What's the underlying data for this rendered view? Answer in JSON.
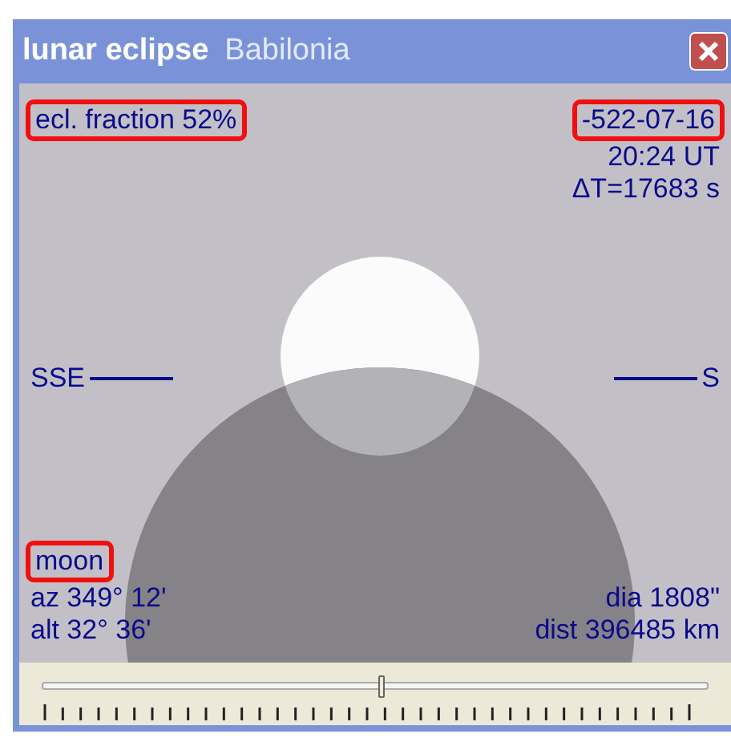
{
  "window": {
    "title": "lunar eclipse",
    "subtitle": "Babilonia"
  },
  "info": {
    "fraction": {
      "text": "ecl. fraction 52%",
      "highlighted": true
    },
    "date": {
      "text": "-522-07-16",
      "highlighted": true
    },
    "time": {
      "text": "20:24 UT",
      "highlighted": false
    },
    "delta_t": {
      "text": "ΔT=17683 s",
      "highlighted": false
    }
  },
  "horizon": {
    "left": "SSE",
    "right": "S"
  },
  "moon": {
    "label": {
      "text": "moon",
      "highlighted": true
    },
    "az": "az 349° 12'",
    "alt": "alt 32° 36'",
    "dia": "dia 1808\"",
    "dist": "dist 396485 km"
  },
  "time_slider": {
    "level": 0.51
  }
}
